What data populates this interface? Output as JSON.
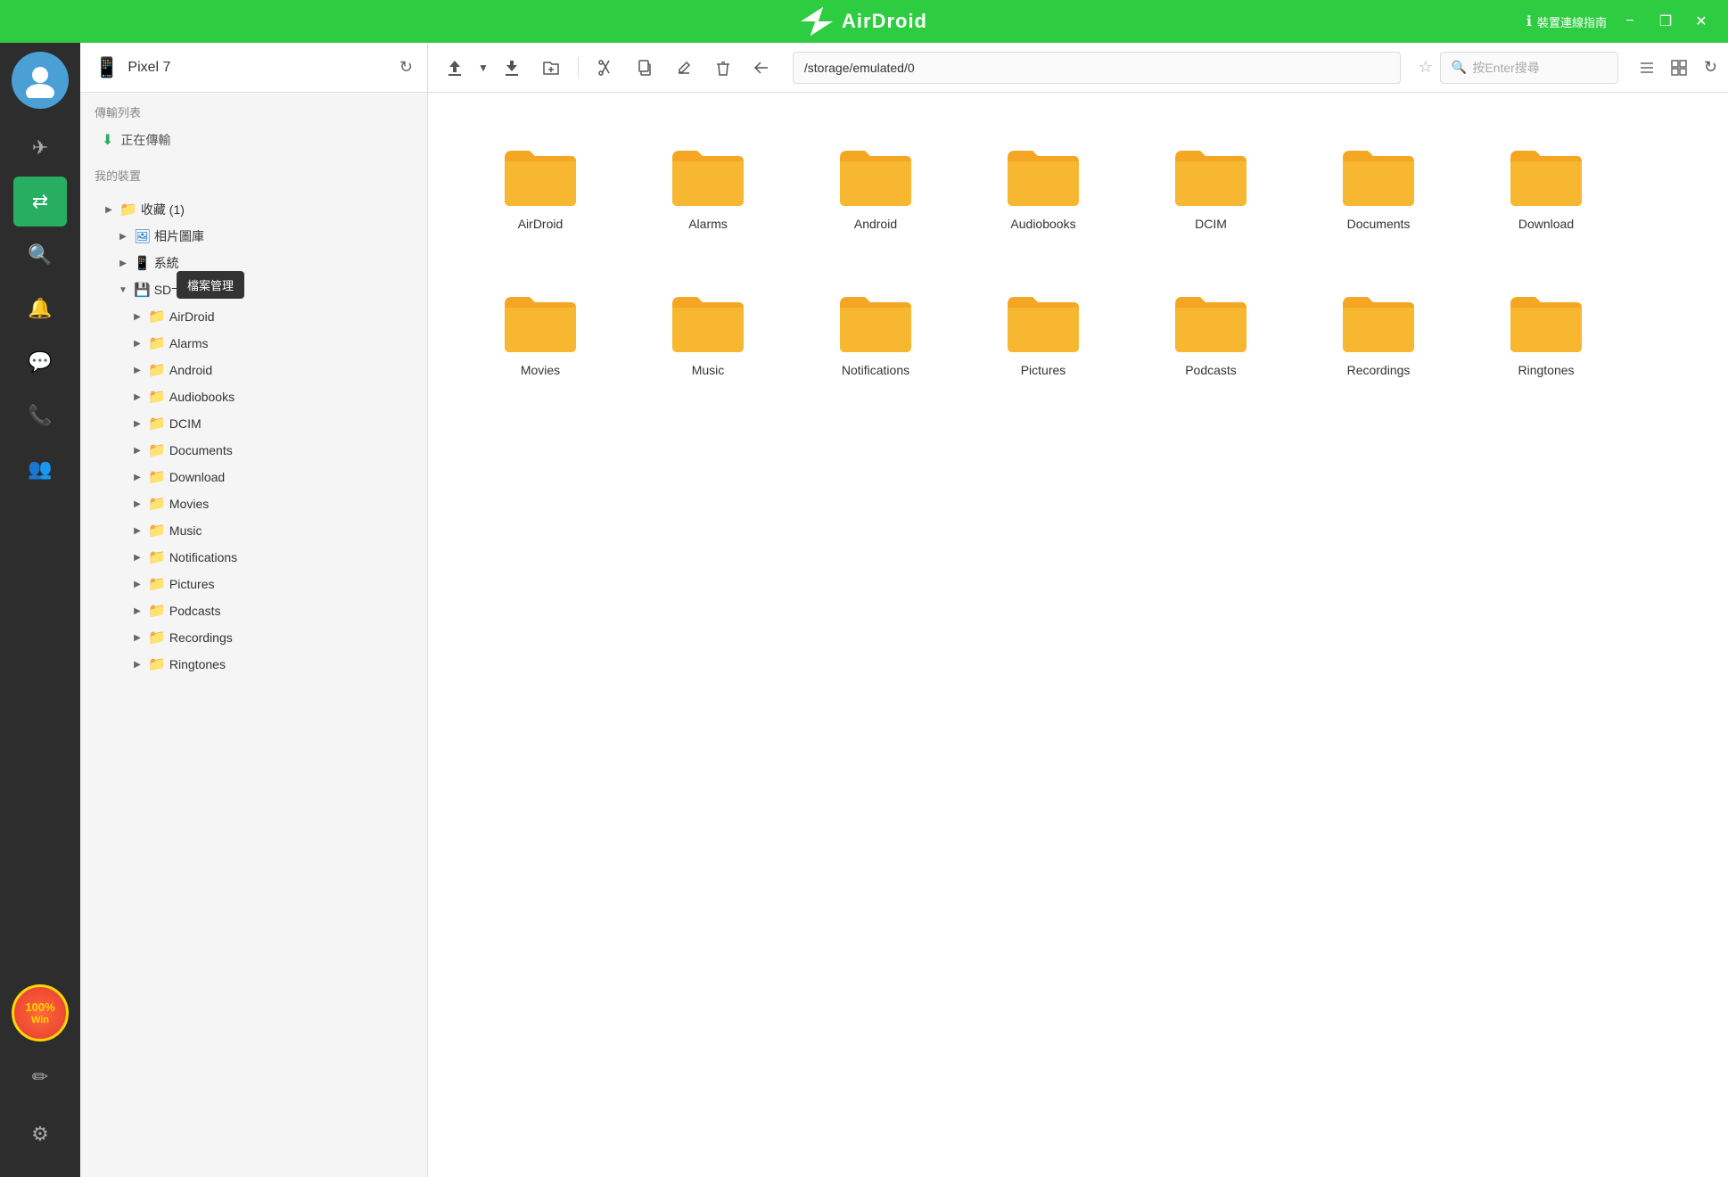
{
  "titlebar": {
    "title": "AirDroid",
    "info_text": "裝置連線指南",
    "minimize_label": "−",
    "restore_label": "❐",
    "close_label": "✕"
  },
  "sidebar": {
    "icons": [
      {
        "name": "send-icon",
        "glyph": "✈",
        "active": false
      },
      {
        "name": "transfer-icon",
        "glyph": "⇄",
        "active": true
      },
      {
        "name": "find-icon",
        "glyph": "👁",
        "active": false
      },
      {
        "name": "notification-icon",
        "glyph": "🔔",
        "active": false
      },
      {
        "name": "chat-icon",
        "glyph": "💬",
        "active": false
      },
      {
        "name": "call-icon",
        "glyph": "📞",
        "active": false
      },
      {
        "name": "contacts-icon",
        "glyph": "👥",
        "active": false
      }
    ],
    "bottom_icons": [
      {
        "name": "edit-icon",
        "glyph": "✏"
      },
      {
        "name": "settings-icon",
        "glyph": "⚙"
      }
    ],
    "win_badge": "100%\nWin"
  },
  "file_manager": {
    "device_name": "Pixel 7",
    "transfer_section_label": "傳輸列表",
    "transfer_in_progress": "正在傳輸",
    "my_device_label": "我的裝置",
    "tooltip_text": "檔案管理",
    "tree": {
      "root_item": {
        "label": "收藏 (1)",
        "expanded": true
      },
      "photo_library": {
        "label": "相片圖庫",
        "expanded": false
      },
      "system": {
        "label": "系統",
        "expanded": false
      },
      "sd_card": {
        "label": "SD卡",
        "expanded": true
      },
      "folders": [
        "AirDroid",
        "Alarms",
        "Android",
        "Audiobooks",
        "DCIM",
        "Documents",
        "Download",
        "Movies",
        "Music",
        "Notifications",
        "Pictures",
        "Podcasts",
        "Recordings",
        "Ringtones"
      ]
    }
  },
  "file_view": {
    "path": "/storage/emulated/0",
    "search_placeholder": "按Enter搜尋",
    "folders": [
      "AirDroid",
      "Alarms",
      "Android",
      "Audiobooks",
      "DCIM",
      "Documents",
      "Download",
      "Movies",
      "Music",
      "Notifications",
      "Pictures",
      "Podcasts",
      "Recordings",
      "Ringtones"
    ]
  }
}
